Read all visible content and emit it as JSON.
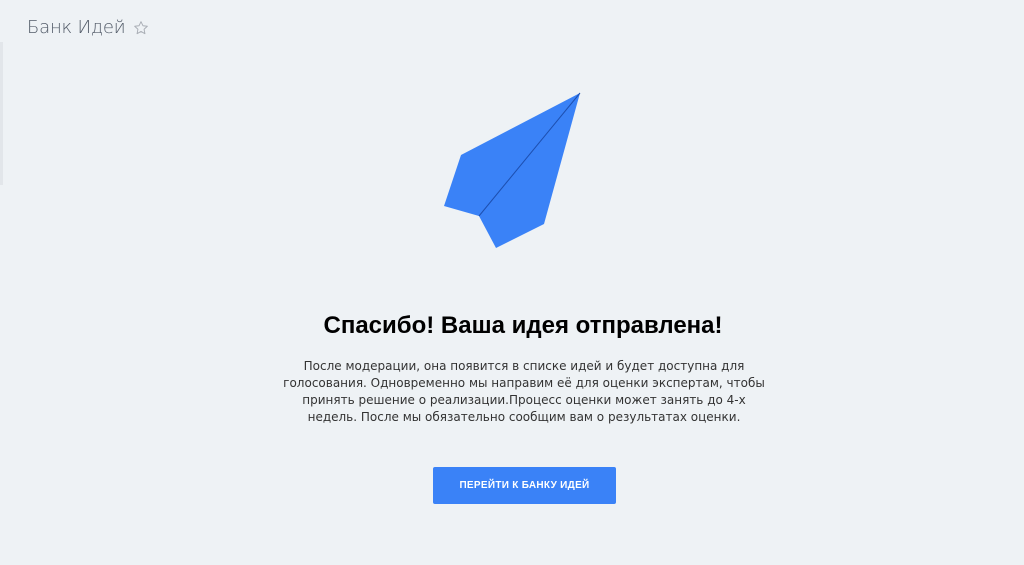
{
  "header": {
    "title": "Банк Идей",
    "favorite_icon": "star-outline-icon"
  },
  "illustration": {
    "icon": "paper-plane-icon",
    "color": "#3a82f7"
  },
  "message": {
    "heading": "Спасибо! Ваша идея отправлена!",
    "body": "После модерации, она появится в списке идей и будет доступна для голосования. Одновременно мы направим её для оценки экспертам, чтобы принять решение о реализации.Процесс оценки может занять до 4-х недель. После мы обязательно сообщим вам о результатах оценки."
  },
  "actions": {
    "go_to_bank_label": "ПЕРЕЙТИ К БАНКУ ИДЕЙ"
  },
  "colors": {
    "background": "#eef2f5",
    "accent": "#3a82f7",
    "title": "#535c69"
  }
}
